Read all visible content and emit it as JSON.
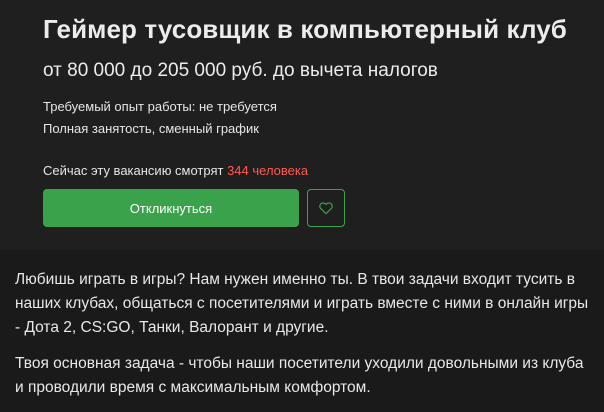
{
  "vacancy": {
    "title": "Геймер тусовщик в компьютерный клуб",
    "salary": "от 80 000 до 205 000 руб. до вычета налогов",
    "experience": "Требуемый опыт работы: не требуется",
    "employment": "Полная занятость, сменный график",
    "viewers_prefix": "Сейчас эту вакансию смотрят ",
    "viewers_count": "344 человека"
  },
  "actions": {
    "apply_label": "Откликнуться",
    "favorite_icon": "heart-icon"
  },
  "description": {
    "paragraph_1": "Любишь играть в игры? Нам нужен именно ты. В твои задачи входит тусить в наших клубах, общаться с посетителями и играть вместе с ними в онлайн игры - Дота 2, CS:GO, Танки, Валорант и другие.",
    "paragraph_2": "Твоя основная задача - чтобы наши посетители уходили довольными из клуба и проводили время с максимальным комфортом."
  },
  "colors": {
    "background": "#1a1a1a",
    "card": "#1f1f1f",
    "accent_green": "#3aa24a",
    "viewers_red": "#ff5a51"
  }
}
